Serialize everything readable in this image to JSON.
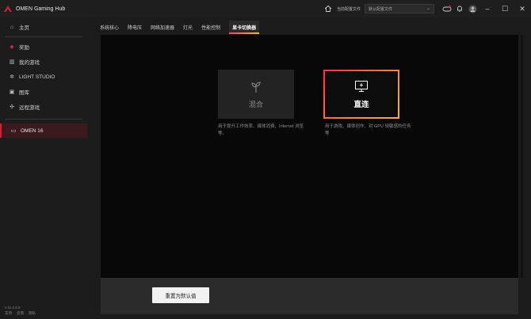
{
  "app": {
    "title": "OMEN Gaming Hub",
    "profile_label": "当前配置文件",
    "profile_value": "默认配置文件",
    "version": "v 11.4.4.0",
    "footer_links": [
      "支持",
      "反馈",
      "隐私"
    ]
  },
  "sidebar": {
    "items": [
      {
        "label": "主页",
        "icon": "home-icon"
      },
      {
        "label": "奖励",
        "icon": "reward-icon"
      },
      {
        "label": "我的游戏",
        "icon": "library-icon"
      },
      {
        "label": "LIGHT STUDIO",
        "icon": "light-studio-icon"
      },
      {
        "label": "图库",
        "icon": "gallery-icon"
      },
      {
        "label": "远程游戏",
        "icon": "remote-play-icon"
      }
    ],
    "device": {
      "label": "OMEN 16",
      "icon": "laptop-icon"
    }
  },
  "tabs": [
    {
      "label": "系统核心",
      "active": false
    },
    {
      "label": "降电压",
      "active": false
    },
    {
      "label": "网络加速器",
      "active": false
    },
    {
      "label": "灯光",
      "active": false
    },
    {
      "label": "性能控制",
      "active": false
    },
    {
      "label": "显卡切换器",
      "active": true
    }
  ],
  "modes": {
    "mix": {
      "label": "混合",
      "description": "用于提升工作效率、媒体消费、Internet 浏览等。",
      "icon": "sprout-icon"
    },
    "direct": {
      "label": "直连",
      "description": "用于游戏、媒体创作、对 GPU 较敏感的任务等",
      "icon": "monitor-icon"
    }
  },
  "actions": {
    "reset_label": "重置为默认值"
  },
  "colors": {
    "accent_start": "#ff2a5a",
    "accent_end": "#ffb12a",
    "active_device_bg": "#3a1a1d",
    "brand_red": "#d21f33"
  }
}
